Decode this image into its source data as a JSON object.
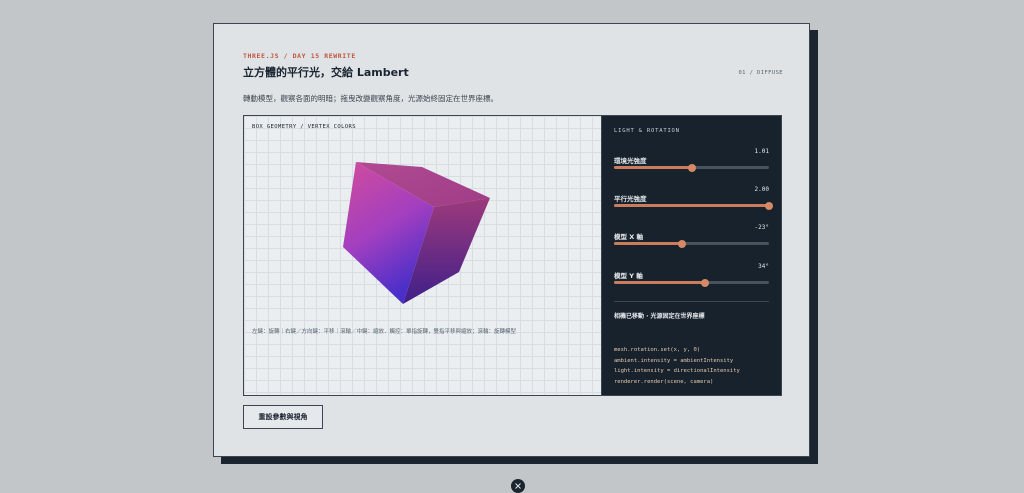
{
  "header": {
    "eyebrow": "THREE.JS / DAY 15 REWRITE",
    "title": "立方體的平行光，交給 Lambert",
    "page_num": "01 / DIFFUSE",
    "subtitle": "轉動模型，觀察各面的明暗；拖曳改變觀察角度，光源始終固定在世界座標。"
  },
  "viewport": {
    "label": "BOX GEOMETRY / VERTEX COLORS",
    "hint": "左鍵：旋轉｜右鍵／方向鍵：平移｜滾輪／中鍵：縮放．觸控：單指旋轉，雙指平移與縮放；滾輪：旋轉模型"
  },
  "controls": {
    "title": "LIGHT & ROTATION",
    "sliders": [
      {
        "label": "環境光強度",
        "value": "1.01",
        "fraction": 0.505
      },
      {
        "label": "平行光強度",
        "value": "2.00",
        "fraction": 1.0
      },
      {
        "label": "模型 X 軸",
        "value": "-23°",
        "fraction": 0.44
      },
      {
        "label": "模型 Y 軸",
        "value": "34°",
        "fraction": 0.59
      }
    ],
    "status": "相機已移動 · 光源固定在世界座標",
    "code": [
      "mesh.rotation.set(x, y, 0)",
      "ambient.intensity = ambientIntensity",
      "light.intensity = directionalIntensity",
      "renderer.render(scene, camera)"
    ]
  },
  "actions": {
    "reset_label": "重設參數與視角"
  },
  "colors": {
    "accent": "#c0563f",
    "slider": "#c97d5c",
    "panel_dark": "#17222c",
    "cube_magenta": "#c8448f",
    "cube_violet": "#4b2fc9"
  }
}
